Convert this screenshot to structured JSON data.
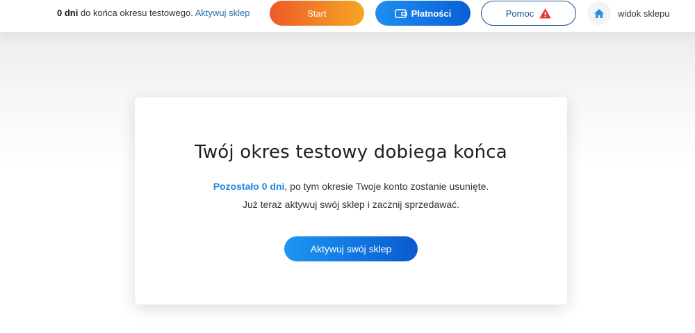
{
  "topbar": {
    "trial_days": "0 dni",
    "trial_text": " do końca okresu testowego. ",
    "activate_link": "Aktywuj sklep",
    "start_label": "Start",
    "payments_label": "Płatności",
    "help_label": "Pomoc",
    "shop_view_label": "widok sklepu"
  },
  "icons": {
    "payments": "wallet-icon",
    "help": "warning-icon",
    "shop_view": "home-icon"
  },
  "card": {
    "title": "Twój okres testowy dobiega końca",
    "remaining_highlight": "Pozostało 0 dni",
    "remaining_rest": ", po tym okresie Twoje konto zostanie usunięte.",
    "line2": "Już teraz aktywuj swój sklep i zacznij sprzedawać.",
    "activate_button": "Aktywuj swój sklep"
  },
  "colors": {
    "accent_blue": "#1a8ae6",
    "start_gradient_from": "#ee5a2a",
    "start_gradient_to": "#f5a623",
    "warning_red": "#e53935"
  }
}
